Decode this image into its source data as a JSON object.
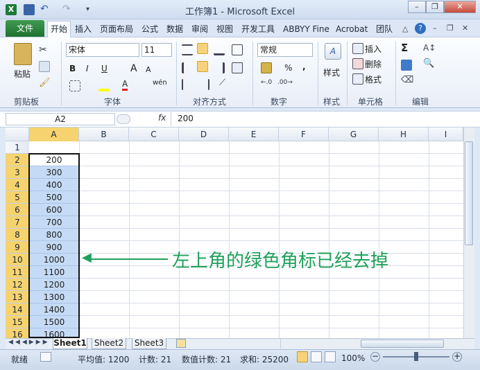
{
  "title": "工作簿1 - Microsoft Excel",
  "quick_access": {
    "app_icon": "excel-icon",
    "save": "save-icon",
    "undo": "undo-icon",
    "redo": "redo-icon"
  },
  "window_buttons": {
    "minimize": "–",
    "restore": "❐",
    "close": "✕"
  },
  "menu": {
    "file": "文件",
    "tabs": [
      "开始",
      "插入",
      "页面布局",
      "公式",
      "数据",
      "审阅",
      "视图",
      "开发工具",
      "ABBYY Fine",
      "Acrobat",
      "团队"
    ]
  },
  "ribbon": {
    "clipboard": {
      "label": "剪贴板",
      "paste": "粘贴"
    },
    "font": {
      "label": "字体",
      "name": "宋体",
      "size": "11",
      "bold": "B",
      "italic": "I",
      "underline": "U",
      "grow": "A",
      "shrink": "A",
      "wen": "wén"
    },
    "alignment": {
      "label": "对齐方式"
    },
    "number": {
      "label": "数字",
      "format": "常规",
      "percent": "%",
      "comma": ","
    },
    "styles": {
      "label": "样式",
      "button": "样式"
    },
    "cells": {
      "label": "单元格",
      "insert": "插入",
      "delete": "删除",
      "format": "格式"
    },
    "editing": {
      "label": "编辑"
    }
  },
  "formula_bar": {
    "name_box": "A2",
    "fx": "fx",
    "value": "200"
  },
  "columns": [
    "A",
    "B",
    "C",
    "D",
    "E",
    "F",
    "G",
    "H",
    "I"
  ],
  "rows": [
    "1",
    "2",
    "3",
    "4",
    "5",
    "6",
    "7",
    "8",
    "9",
    "10",
    "11",
    "12",
    "13",
    "14",
    "15",
    "16"
  ],
  "cells_a": [
    "",
    "200",
    "300",
    "400",
    "500",
    "600",
    "700",
    "800",
    "900",
    "1000",
    "1100",
    "1200",
    "1300",
    "1400",
    "1500",
    "1600"
  ],
  "annotation": "左上角的绿色角标已经去掉",
  "sheets": [
    "Sheet1",
    "Sheet2",
    "Sheet3"
  ],
  "status": {
    "ready": "就绪",
    "average": "平均值: 1200",
    "count": "计数: 21",
    "numeric_count": "数值计数: 21",
    "sum": "求和: 25200",
    "zoom": "100%",
    "zoom_value": 100
  },
  "colors": {
    "accent": "#1f7232",
    "selection": "#c5dbf5",
    "row_header_selected": "#f6d36e",
    "annotation": "#1ea15a"
  }
}
